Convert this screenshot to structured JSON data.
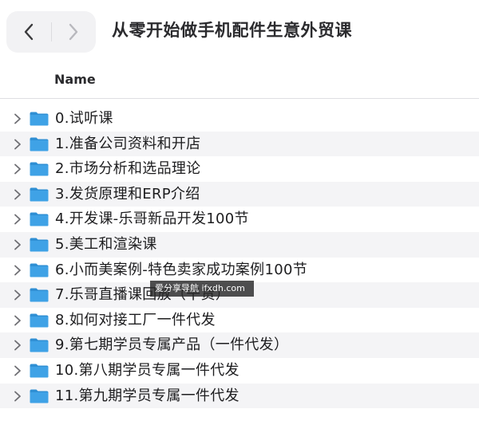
{
  "window": {
    "title": "从零开始做手机配件生意外贸课"
  },
  "list": {
    "column_header": "Name",
    "items": [
      {
        "label": "0.试听课"
      },
      {
        "label": "1.准备公司资料和开店"
      },
      {
        "label": "2.市场分析和选品理论"
      },
      {
        "label": "3.发货原理和ERP介绍"
      },
      {
        "label": "4.开发课-乐哥新品开发100节"
      },
      {
        "label": "5.美工和渲染课"
      },
      {
        "label": "6.小而美案例-特色卖家成功案例100节"
      },
      {
        "label": "7.乐哥直播课回放（干货）"
      },
      {
        "label": "8.如何对接工厂一件代发"
      },
      {
        "label": "9.第七期学员专属产品（一件代发）"
      },
      {
        "label": "10.第八期学员专属一件代发"
      },
      {
        "label": "11.第九期学员专属一件代发"
      }
    ]
  },
  "watermark": {
    "text": "爱分享导航 ifxdh.com"
  },
  "colors": {
    "folder": "#3fa2e6",
    "folder_tab": "#2f8fd4",
    "row_alt": "#f4f4f6"
  },
  "icons": {
    "back": "chevron-left-icon",
    "forward": "chevron-right-icon",
    "disclosure": "chevron-right-icon",
    "folder": "folder-icon"
  }
}
